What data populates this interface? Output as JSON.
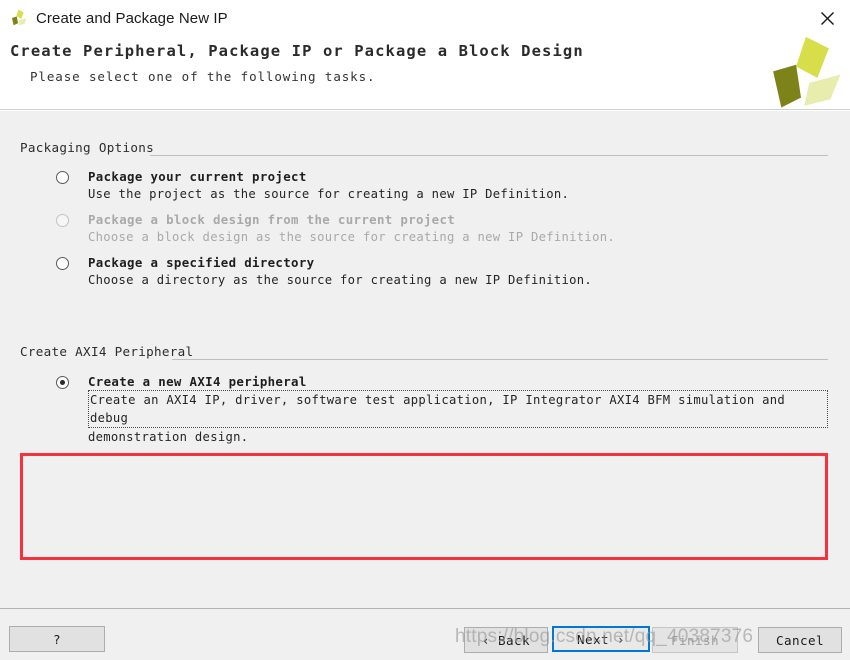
{
  "window": {
    "title": "Create and Package New IP",
    "icon": "xilinx-logo-icon",
    "close_label": "✕"
  },
  "header": {
    "title": "Create Peripheral, Package IP or Package a Block Design",
    "subtitle": "Please select one of the following tasks.",
    "logo": "xilinx-logo-icon"
  },
  "groups": [
    {
      "name": "packaging-options",
      "title": "Packaging Options",
      "options": [
        {
          "title": "Package your current project",
          "desc": "Use the project as the source for creating a new IP Definition.",
          "selected": false,
          "disabled": false
        },
        {
          "title": "Package a block design from the current project",
          "desc": "Choose a block design as the source for creating a new IP Definition.",
          "selected": false,
          "disabled": true
        },
        {
          "title": "Package a specified directory",
          "desc": "Choose a directory as the source for creating a new IP Definition.",
          "selected": false,
          "disabled": false
        }
      ]
    },
    {
      "name": "create-axi4-peripheral",
      "title": "Create AXI4 Peripheral",
      "options": [
        {
          "title": "Create a new AXI4 peripheral",
          "desc": "Create an AXI4 IP, driver, software test application, IP Integrator AXI4 BFM simulation and debug",
          "desc2": "demonstration design.",
          "selected": true,
          "disabled": false
        }
      ]
    }
  ],
  "footer": {
    "help_label": "?",
    "back_label": "‹ Back",
    "next_label": "Next ›",
    "next_mnemonic": "N",
    "back_mnemonic": "B",
    "finish_label": "Finish",
    "cancel_label": "Cancel"
  },
  "watermark": {
    "text": "https://blog.csdn.net/qq_40387376"
  },
  "colors": {
    "accent_blue": "#0078d7",
    "annotation_red": "#f5333f",
    "body_bg": "#f0f0f0",
    "logo_dark": "#7d8219",
    "logo_mid": "#d8dd4a",
    "logo_light": "#e8ecad"
  }
}
